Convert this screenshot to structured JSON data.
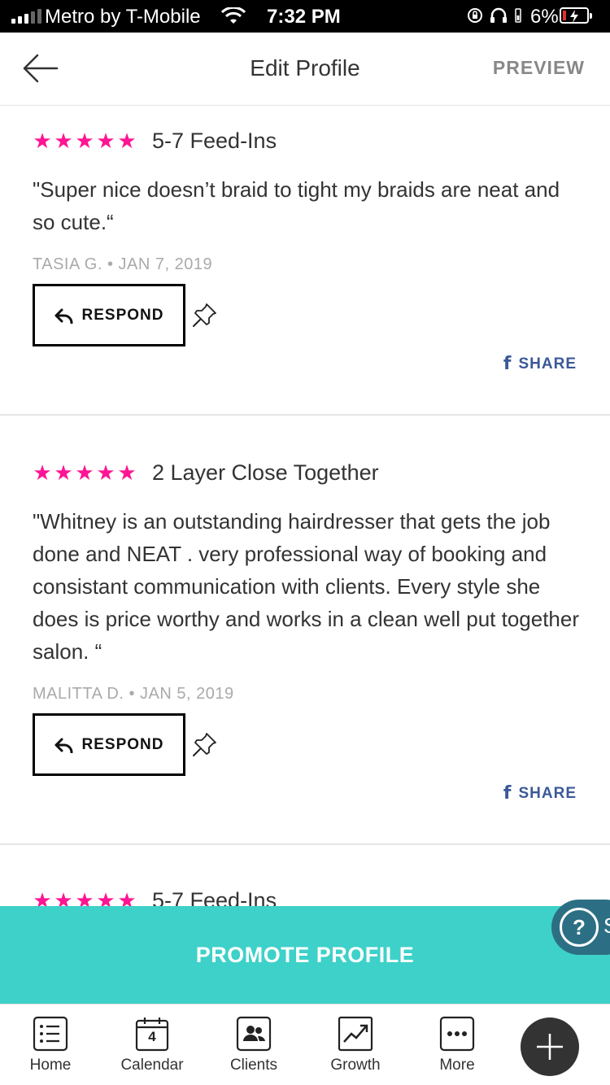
{
  "status_bar": {
    "carrier": "Metro by T-Mobile",
    "time": "7:32 PM",
    "battery": "6%"
  },
  "header": {
    "title": "Edit Profile",
    "preview_label": "PREVIEW"
  },
  "reviews": [
    {
      "rating": 5,
      "service": "5-7 Feed-Ins",
      "text": "\"Super nice doesn’t braid to tight my braids are neat and so cute.“",
      "author": "TASIA G.",
      "date": "JAN 7, 2019",
      "respond_label": "RESPOND",
      "share_label": "SHARE"
    },
    {
      "rating": 5,
      "service": "2 Layer Close Together",
      "text": "\"Whitney is an outstanding hairdresser that gets the job done and NEAT . very professional way of booking and consistant communication with clients. Every style she does is price worthy and works in a clean well put together salon. “",
      "author": "MALITTA D.",
      "date": "JAN 5, 2019",
      "respond_label": "RESPOND",
      "share_label": "SHARE"
    },
    {
      "rating": 5,
      "service": "5-7 Feed-Ins"
    }
  ],
  "promote": {
    "label": "PROMOTE PROFILE"
  },
  "help": {
    "label": "?",
    "partial_text": "S"
  },
  "tabbar": {
    "items": [
      {
        "label": "Home",
        "icon": "list-icon"
      },
      {
        "label": "Calendar",
        "icon": "calendar-icon",
        "badge": "4"
      },
      {
        "label": "Clients",
        "icon": "clients-icon"
      },
      {
        "label": "Growth",
        "icon": "growth-chart-icon"
      },
      {
        "label": "More",
        "icon": "more-dots-icon"
      }
    ],
    "fab_icon": "plus-icon"
  },
  "colors": {
    "star": "#ff1493",
    "promote_bg": "#3dd1c9",
    "facebook": "#3b5998",
    "help_bg": "#2c6f85"
  }
}
